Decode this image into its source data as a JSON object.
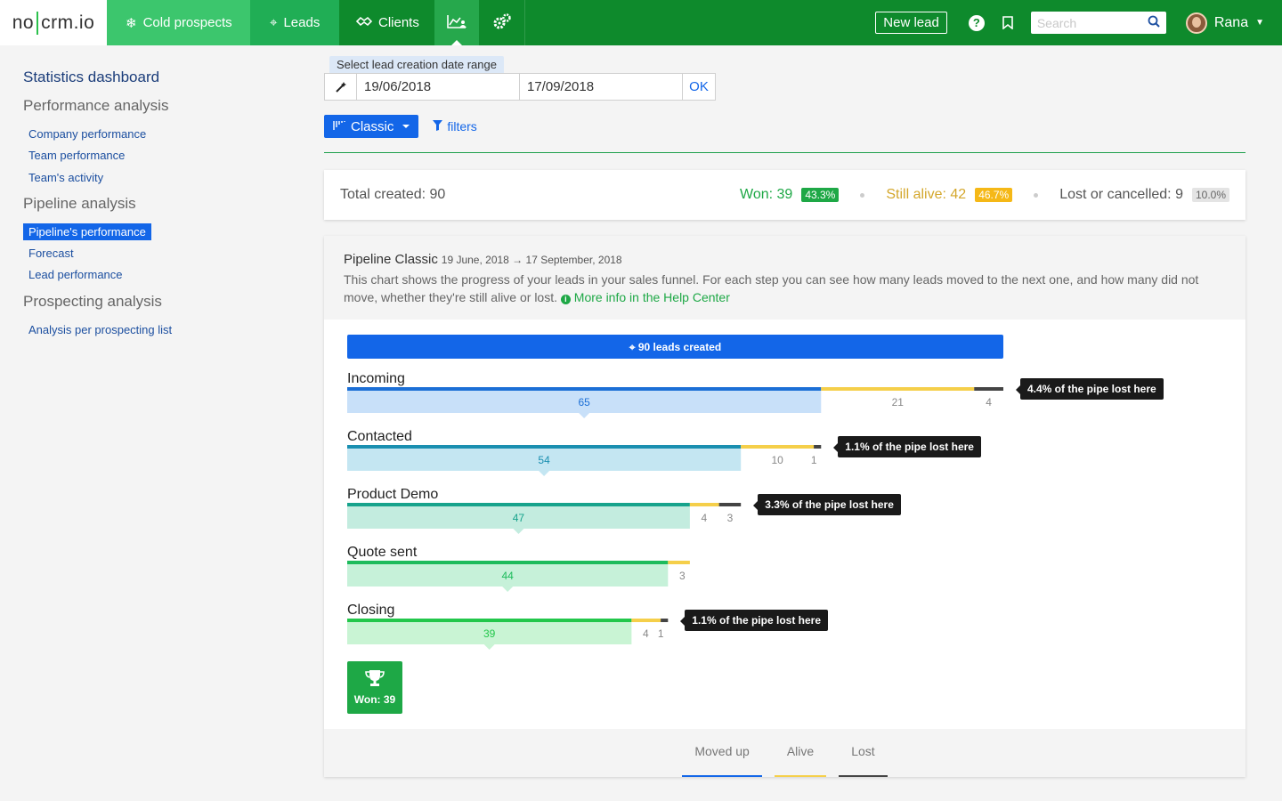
{
  "nav": {
    "logo_left": "no",
    "logo_right": "crm.io",
    "tabs": [
      {
        "label": "Cold prospects"
      },
      {
        "label": "Leads"
      },
      {
        "label": "Clients"
      }
    ],
    "new_lead_label": "New lead",
    "search_placeholder": "Search",
    "user_name": "Rana"
  },
  "sidebar": {
    "title": "Statistics dashboard",
    "sections": [
      {
        "heading": "Performance analysis",
        "items": [
          "Company performance",
          "Team performance",
          "Team's activity"
        ]
      },
      {
        "heading": "Pipeline analysis",
        "items": [
          "Pipeline's performance",
          "Forecast",
          "Lead performance"
        ]
      },
      {
        "heading": "Prospecting analysis",
        "items": [
          "Analysis per prospecting list"
        ]
      }
    ],
    "active_item": "Pipeline's performance"
  },
  "filters": {
    "range_label": "Select lead creation date range",
    "start_date": "19/06/2018",
    "end_date": "17/09/2018",
    "ok_label": "OK",
    "view_label": "Classic",
    "filters_label": "filters"
  },
  "summary": {
    "total": "Total created: 90",
    "won": "Won: 39",
    "won_pct": "43.3%",
    "alive": "Still alive: 42",
    "alive_pct": "46.7%",
    "lost": "Lost or cancelled: 9",
    "lost_pct": "10.0%"
  },
  "panel": {
    "title": "Pipeline Classic",
    "dates": "19 June, 2018 → 17 September, 2018",
    "description": "This chart shows the progress of your leads in your sales funnel. For each step you can see how many leads moved to the next one, and how many did not move, whether they're still alive or lost.",
    "help_link": "More info in the Help Center",
    "created_label": "90 leads created",
    "won_label": "Won: 39"
  },
  "colors": {
    "moved_up": "#1366e8",
    "alive": "#f5cf4a",
    "lost": "#444444",
    "green": "#1ea846"
  },
  "chart_data": {
    "type": "bar",
    "total": 90,
    "categories": [
      "Incoming",
      "Contacted",
      "Product Demo",
      "Quote sent",
      "Closing"
    ],
    "series": [
      {
        "name": "Moved up",
        "values": [
          65,
          54,
          47,
          44,
          39
        ]
      },
      {
        "name": "Alive",
        "values": [
          21,
          10,
          4,
          3,
          4
        ]
      },
      {
        "name": "Lost",
        "values": [
          4,
          1,
          3,
          0,
          1
        ]
      }
    ],
    "lost_notes": [
      "4.4% of the pipe lost here",
      "1.1% of the pipe lost here",
      "3.3% of the pipe lost here",
      "",
      "1.1% of the pipe lost here"
    ],
    "legend": [
      "Moved up",
      "Alive",
      "Lost"
    ]
  }
}
